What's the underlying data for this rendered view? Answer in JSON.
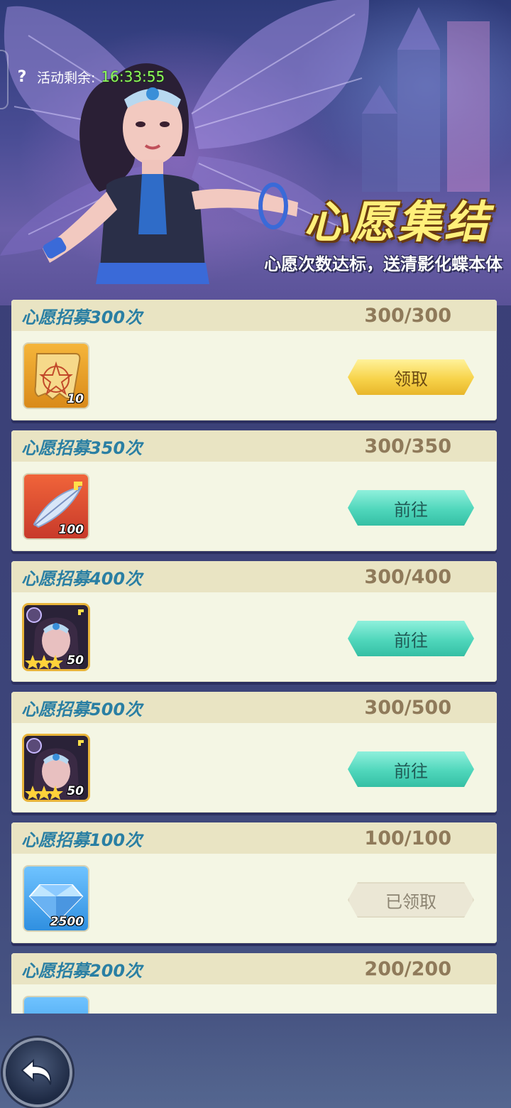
{
  "banner": {
    "timer_label": "活动剩余:",
    "timer_value": "16:33:55",
    "title": "心愿集结",
    "subtitle": "心愿次数达标，送清影化蝶本体"
  },
  "tasks": [
    {
      "name": "心愿招募300次",
      "progress": "300/300",
      "reward_icon": "scroll-icon",
      "reward_qty": "10",
      "button": "领取",
      "state": "claimable"
    },
    {
      "name": "心愿招募350次",
      "progress": "300/350",
      "reward_icon": "feather-icon",
      "reward_qty": "100",
      "button": "前往",
      "state": "goto"
    },
    {
      "name": "心愿招募400次",
      "progress": "300/400",
      "reward_icon": "hero-portrait-icon",
      "reward_qty": "50",
      "button": "前往",
      "state": "goto"
    },
    {
      "name": "心愿招募500次",
      "progress": "300/500",
      "reward_icon": "hero-portrait-icon",
      "reward_qty": "50",
      "button": "前往",
      "state": "goto"
    },
    {
      "name": "心愿招募100次",
      "progress": "100/100",
      "reward_icon": "diamond-icon",
      "reward_qty": "2500",
      "button": "已领取",
      "state": "claimed"
    },
    {
      "name": "心愿招募200次",
      "progress": "200/200",
      "reward_icon": "diamond-icon",
      "reward_qty": "",
      "button": "",
      "state": "partial"
    }
  ],
  "colors": {
    "claim_button": "#f7d34a",
    "goto_button": "#4fd6bb",
    "claimed_button": "#ebe7d5",
    "task_name": "#2a7fa3",
    "progress_text": "#8f7a5a",
    "timer_value": "#8dff5a"
  }
}
